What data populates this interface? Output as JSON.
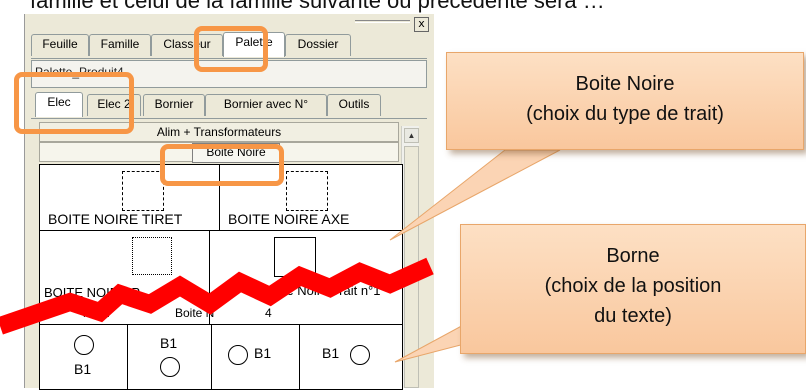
{
  "top_text": "famille et celui de la famille suivante ou précédente sera …",
  "window": {
    "close_glyph": "x",
    "main_tabs": [
      {
        "label": "Feuille",
        "active": false
      },
      {
        "label": "Famille",
        "active": false
      },
      {
        "label": "Classeur",
        "active": false
      },
      {
        "label": "Palette",
        "active": true
      },
      {
        "label": "Dossier",
        "active": false
      }
    ],
    "palette_name": "Palette_Produit4",
    "sub_tabs": [
      {
        "label": "Elec",
        "active": true
      },
      {
        "label": "Elec 2",
        "active": false
      },
      {
        "label": "Bornier",
        "active": false
      },
      {
        "label": "Bornier avec N°",
        "active": false
      },
      {
        "label": "Outils",
        "active": false
      }
    ],
    "group_header": "Alim + Transformateurs",
    "category_button": "Boite Noire",
    "palette_row1": [
      "BOITE NOIRE TIRET",
      "BOITE NOIRE AXE"
    ],
    "palette_row2": [
      "BOITE NOIRE P",
      "Boite Noire Trait n°1",
      "Boite N",
      "rait n",
      "4"
    ],
    "borne_label": "B1"
  },
  "callouts": {
    "boite_noire": [
      "Boite Noire",
      "(choix du type de trait)"
    ],
    "borne": [
      "Borne",
      "(choix de la position",
      "du texte)"
    ]
  },
  "colors": {
    "highlight": "#f79646",
    "callout_fill": "#fbd4b4",
    "zigzag": "#ff0000"
  }
}
